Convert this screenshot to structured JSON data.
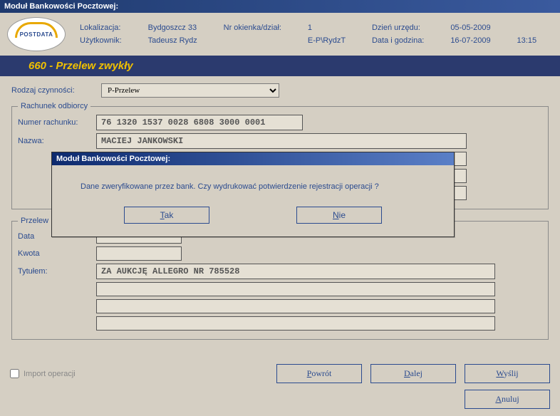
{
  "app": {
    "title": "Moduł Bankowości Pocztowej:"
  },
  "header": {
    "loc_label": "Lokalizacja:",
    "loc_value": "Bydgoszcz 33",
    "window_label": "Nr okienka/dział:",
    "window_value": "1",
    "office_date_label": "Dzień urzędu:",
    "office_date_value": "05-05-2009",
    "user_label": "Użytkownik:",
    "user_value": "Tadeusz Rydz",
    "ep_value": "E-P\\RydzT",
    "datetime_label": "Data i godzina:",
    "date_value": "16-07-2009",
    "time_value": "13:15"
  },
  "nav": {
    "title": "660 - Przelew zwykły"
  },
  "form": {
    "type_label": "Rodzaj czynności:",
    "type_value": "P-Przelew",
    "recipient_legend": "Rachunek odbiorcy",
    "account_label": "Numer rachunku:",
    "account_value": "76 1320 1537 0028 6808 3000 0001",
    "name_label": "Nazwa:",
    "name_value": "MACIEJ JANKOWSKI",
    "transfer_legend": "Przelew",
    "date_label": "Data",
    "amount_label": "Kwota",
    "title_label": "Tytułem:",
    "title_value": "ZA AUKCJĘ ALLEGRO NR 785528"
  },
  "footer": {
    "import_label": "Import operacji",
    "back": "Powrót",
    "next": "Dalej",
    "send": "Wyślij",
    "cancel": "Anuluj"
  },
  "dialog": {
    "title": "Moduł Bankowości Pocztowej:",
    "message": "Dane zweryfikowane przez bank. Czy wydrukować potwierdzenie rejestracji operacji ?",
    "yes": "Tak",
    "no": "Nie"
  }
}
